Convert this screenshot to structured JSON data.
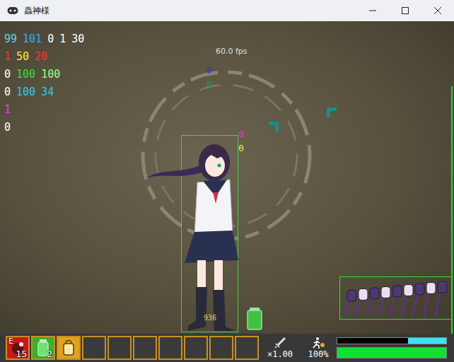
{
  "window": {
    "title": "蟲神様"
  },
  "fps": "60.0 fps",
  "debug_rows": [
    [
      {
        "text": "99",
        "color": "#5fd0f0"
      },
      {
        "text": "101",
        "color": "#3aa8f0"
      },
      {
        "text": "0",
        "color": "#ffffff"
      },
      {
        "text": "1",
        "color": "#ffffff"
      },
      {
        "text": "30",
        "color": "#ffffff"
      }
    ],
    [
      {
        "text": "1",
        "color": "#ff3030"
      },
      {
        "text": "50",
        "color": "#ffee30"
      },
      {
        "text": "20",
        "color": "#ff3030"
      }
    ],
    [
      {
        "text": "0",
        "color": "#ffffff"
      },
      {
        "text": "100",
        "color": "#30e030"
      },
      {
        "text": "100",
        "color": "#a0ff80"
      }
    ],
    [
      {
        "text": "0",
        "color": "#ffffff"
      },
      {
        "text": "100",
        "color": "#30c8f0"
      },
      {
        "text": "34",
        "color": "#30c8f0"
      }
    ],
    [
      {
        "text": "1",
        "color": "#ff30ff"
      }
    ],
    [
      {
        "text": "0",
        "color": "#ffffff"
      }
    ]
  ],
  "markers": [
    {
      "text": "0",
      "color": "#2838c8"
    },
    {
      "text": "0",
      "color": "#20a040"
    },
    {
      "text": "0",
      "color": "#e030e0"
    },
    {
      "text": "0",
      "color": "#f0f030"
    }
  ],
  "player": {
    "damage": "936"
  },
  "hud": {
    "slots": [
      {
        "kind": "weapon",
        "label": "E",
        "count": "15",
        "color": "#c81818"
      },
      {
        "kind": "item",
        "label": "",
        "count": "2",
        "color": "#38b030"
      },
      {
        "kind": "tool",
        "label": "",
        "count": "",
        "color": "#e0a020"
      },
      {
        "kind": "empty",
        "label": "",
        "count": "",
        "color": "#3a3a3a"
      },
      {
        "kind": "empty",
        "label": "",
        "count": "",
        "color": "#3a3a3a"
      },
      {
        "kind": "empty",
        "label": "",
        "count": "",
        "color": "#3a3a3a"
      },
      {
        "kind": "empty",
        "label": "",
        "count": "",
        "color": "#3a3a3a"
      },
      {
        "kind": "empty",
        "label": "",
        "count": "",
        "color": "#3a3a3a"
      },
      {
        "kind": "empty",
        "label": "",
        "count": "",
        "color": "#3a3a3a"
      },
      {
        "kind": "empty",
        "label": "",
        "count": "",
        "color": "#3a3a3a"
      }
    ],
    "attack": "×1.00",
    "speed": "100%",
    "bars": [
      {
        "name": "stamina",
        "level": 0.35,
        "color": "#40e0f0"
      },
      {
        "name": "health",
        "level": 1.0,
        "color": "#10e030"
      }
    ]
  }
}
